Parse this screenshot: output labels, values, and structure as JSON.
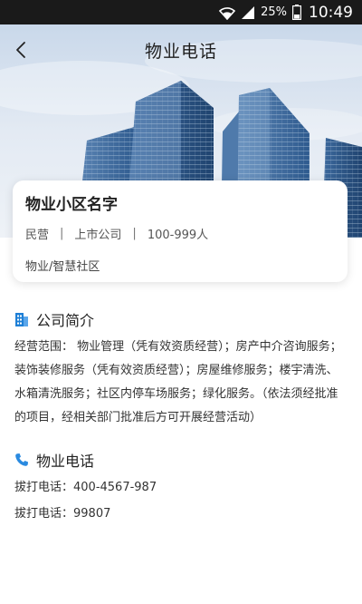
{
  "status_bar": {
    "battery": "25%",
    "time": "10:49"
  },
  "header": {
    "title": "物业电话"
  },
  "company": {
    "name": "物业小区名字",
    "tags": [
      "民营",
      "上市公司",
      "100-999人"
    ],
    "industry": "物业/智慧社区"
  },
  "intro": {
    "heading": "公司简介",
    "text": "经营范围：  物业管理（凭有效资质经营）；房产中介咨询服务；装饰装修服务（凭有效资质经营）；房屋维修服务；楼宇清洗、水箱清洗服务；社区内停车场服务；绿化服务。（依法须经批准的项目，经相关部门批准后方可开展经营活动）"
  },
  "phone": {
    "heading": "物业电话",
    "lines": [
      "拔打电话：400-4567-987",
      "拔打电话：99807"
    ]
  },
  "colors": {
    "accent_blue": "#1e7fd6",
    "phone_blue": "#2a8ae0",
    "status_bg": "#1a1a1a"
  },
  "icons": [
    "wifi-icon",
    "signal-icon",
    "battery-icon",
    "back-arrow-icon",
    "building-icon",
    "phone-icon"
  ]
}
